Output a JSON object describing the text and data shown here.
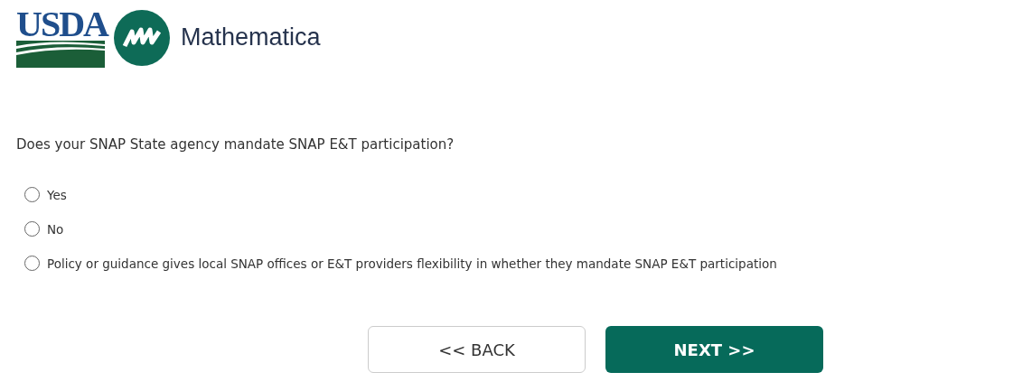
{
  "logos": [
    {
      "kind": "usda",
      "text": "USDA"
    },
    {
      "kind": "mathematica",
      "text": "Mathematica"
    }
  ],
  "question": "Does your SNAP State agency mandate SNAP E&T participation?",
  "options": [
    {
      "label": "Yes",
      "selected": false
    },
    {
      "label": "No",
      "selected": false
    },
    {
      "label": "Policy or guidance gives local SNAP offices or E&T providers flexibility in whether they mandate SNAP E&T participation",
      "selected": false
    }
  ],
  "buttons": [
    {
      "kind": "back",
      "label": "<< BACK"
    },
    {
      "kind": "next",
      "label": "NEXT >>"
    }
  ]
}
